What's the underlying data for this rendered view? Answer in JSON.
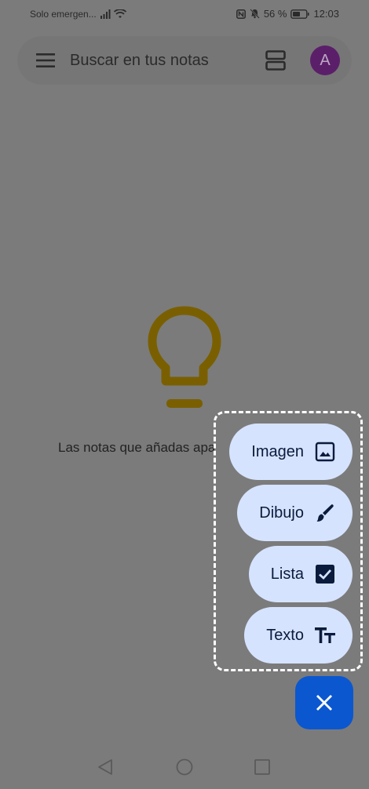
{
  "status_bar": {
    "carrier": "Solo emergen...",
    "battery": "56 %",
    "time": "12:03"
  },
  "search_bar": {
    "placeholder": "Buscar en tus notas",
    "avatar_letter": "A"
  },
  "empty_state": {
    "message": "Las notas que añadas apa"
  },
  "fab_menu": {
    "items": [
      {
        "label": "Imagen",
        "icon": "image-icon"
      },
      {
        "label": "Dibujo",
        "icon": "brush-icon"
      },
      {
        "label": "Lista",
        "icon": "checkbox-icon"
      },
      {
        "label": "Texto",
        "icon": "text-format-icon"
      }
    ]
  },
  "colors": {
    "scrim": "#7b7b7b",
    "pill": "#d6e3ff",
    "fab": "#0b57d0",
    "bulb": "#7a5f00",
    "avatar": "#5b1f6a"
  }
}
